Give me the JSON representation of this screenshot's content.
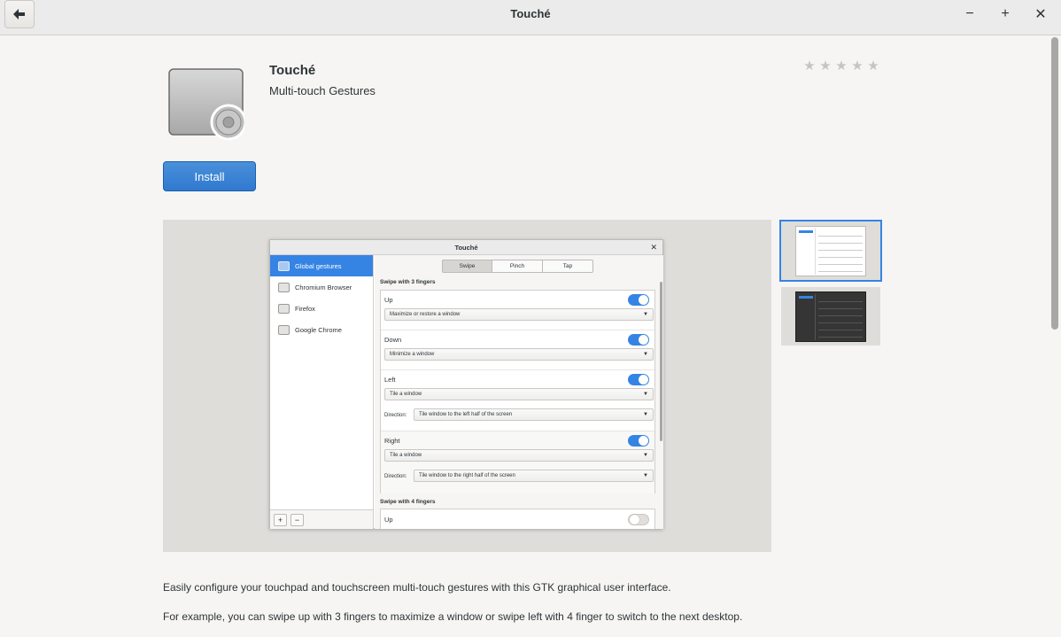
{
  "window": {
    "title": "Touché"
  },
  "controls": {
    "minimize": "−",
    "maximize": "+",
    "close": "✕"
  },
  "app": {
    "name": "Touché",
    "summary": "Multi-touch Gestures",
    "install_label": "Install",
    "rating_stars": 0
  },
  "screenshot_window": {
    "title": "Touché",
    "sidebar": [
      "Global gestures",
      "Chromium Browser",
      "Firefox",
      "Google Chrome"
    ],
    "footer_add": "+",
    "footer_remove": "−",
    "tabs": [
      "Swipe",
      "Pinch",
      "Tap"
    ],
    "active_tab": "Swipe",
    "section_3": "Swipe with 3 fingers",
    "rows": [
      {
        "label": "Up",
        "action": "Maximize or restore a window"
      },
      {
        "label": "Down",
        "action": "Minimize a window"
      },
      {
        "label": "Left",
        "action": "Tile a window",
        "direction_label": "Direction:",
        "direction": "Tile window to the left half of the screen"
      },
      {
        "label": "Right",
        "action": "Tile a window",
        "direction_label": "Direction:",
        "direction": "Tile window to the right half of the screen"
      }
    ],
    "section_4": "Swipe with 4 fingers",
    "row4_label": "Up"
  },
  "description": {
    "p1": "Easily configure your touchpad and touchscreen multi-touch gestures with this GTK graphical user interface.",
    "p2": "For example, you can swipe up with 3 fingers to maximize a window or swipe left with 4 finger to switch to the next desktop."
  },
  "colors": {
    "accent": "#3584e4",
    "install": "#2f79cf"
  }
}
